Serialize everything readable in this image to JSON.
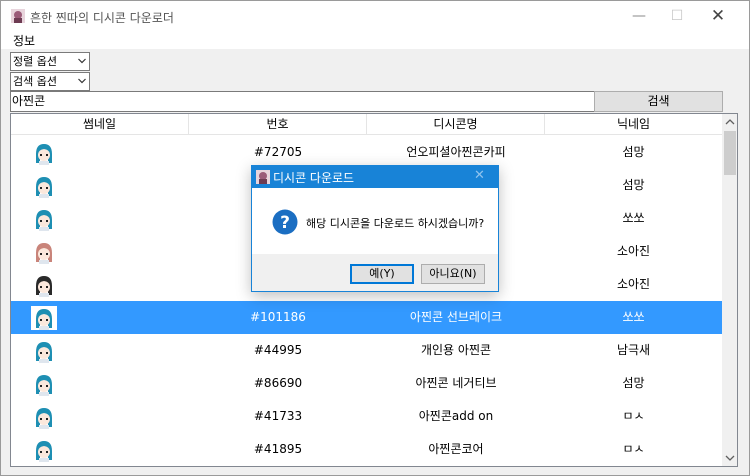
{
  "window": {
    "title": "흔한 찐따의 디시콘 다운로더",
    "minimize_glyph": "—",
    "maximize_glyph": "☐",
    "close_glyph": "✕"
  },
  "menu": {
    "info": "정보"
  },
  "controls": {
    "sort_option": "정렬 옵션",
    "search_option": "검색 옵션",
    "search_value": "아찐콘",
    "search_button": "검색"
  },
  "table": {
    "columns": [
      "썸네일",
      "번호",
      "디시콘명",
      "닉네임"
    ],
    "rows": [
      {
        "number": "#72705",
        "name": "언오피셜아찐콘카피",
        "nick": "섬망",
        "selected": false,
        "thumb": "blue"
      },
      {
        "number": "",
        "name": "",
        "nick": "섬망",
        "selected": false,
        "thumb": "blue"
      },
      {
        "number": "",
        "name": "",
        "nick": "쏘쏘",
        "selected": false,
        "thumb": "blue"
      },
      {
        "number": "",
        "name": "",
        "nick": "소아진",
        "selected": false,
        "thumb": "pink"
      },
      {
        "number": "",
        "name": "",
        "nick": "소아진",
        "selected": false,
        "thumb": "dark"
      },
      {
        "number": "#101186",
        "name": "아찐콘 선브레이크",
        "nick": "쏘쏘",
        "selected": true,
        "thumb": "blue"
      },
      {
        "number": "#44995",
        "name": "개인용 아찐콘",
        "nick": "남극새",
        "selected": false,
        "thumb": "blue"
      },
      {
        "number": "#86690",
        "name": "아찐콘 네거티브",
        "nick": "섬망",
        "selected": false,
        "thumb": "blue"
      },
      {
        "number": "#41733",
        "name": "아찐콘add on",
        "nick": "ㅁㅅ",
        "selected": false,
        "thumb": "blue"
      },
      {
        "number": "#41895",
        "name": "아찐콘코어",
        "nick": "ㅁㅅ",
        "selected": false,
        "thumb": "blue"
      }
    ]
  },
  "dialog": {
    "title": "디시콘 다운로드",
    "message": "해당 디시콘을 다운로드 하시겠습니까?",
    "yes": "예(Y)",
    "no": "아니요(N)",
    "close_glyph": "✕",
    "icon": "question-icon"
  },
  "colors": {
    "selection": "#3399ff",
    "dialog_accent": "#1883d7",
    "thumb_blue": "#1e8fb3",
    "thumb_pink": "#c9847a",
    "thumb_dark": "#2a2a2a"
  }
}
